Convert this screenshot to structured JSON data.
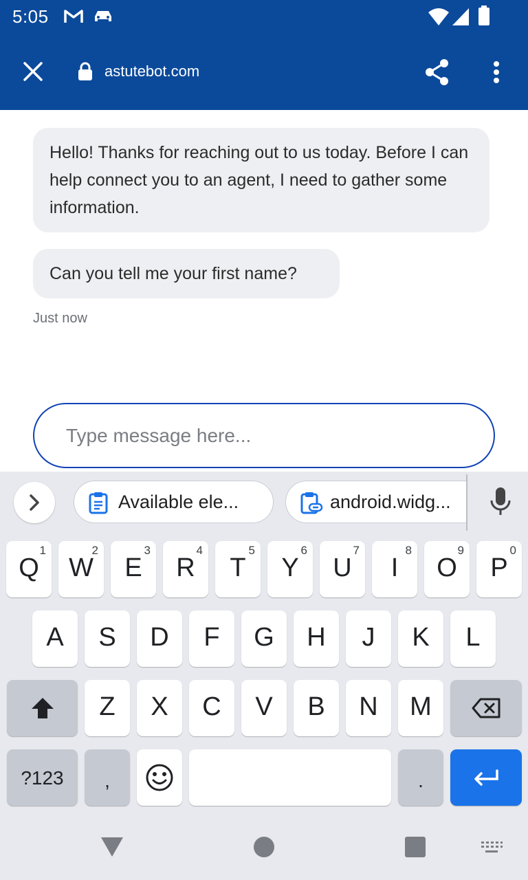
{
  "status": {
    "time": "5:05"
  },
  "browser": {
    "url": "astutebot.com"
  },
  "chat": {
    "messages": [
      "Hello! Thanks for reaching out to us today. Before I can help connect you to an agent, I need to gather some information.",
      "Can you tell me your first name?"
    ],
    "timestamp": "Just now"
  },
  "input": {
    "placeholder": "Type message here...",
    "value": ""
  },
  "keyboard": {
    "suggestions": [
      "Available ele...",
      "android.widg..."
    ],
    "row1": [
      {
        "c": "Q",
        "n": "1"
      },
      {
        "c": "W",
        "n": "2"
      },
      {
        "c": "E",
        "n": "3"
      },
      {
        "c": "R",
        "n": "4"
      },
      {
        "c": "T",
        "n": "5"
      },
      {
        "c": "Y",
        "n": "6"
      },
      {
        "c": "U",
        "n": "7"
      },
      {
        "c": "I",
        "n": "8"
      },
      {
        "c": "O",
        "n": "9"
      },
      {
        "c": "P",
        "n": "0"
      }
    ],
    "row2": [
      "A",
      "S",
      "D",
      "F",
      "G",
      "H",
      "J",
      "K",
      "L"
    ],
    "row3": [
      "Z",
      "X",
      "C",
      "V",
      "B",
      "N",
      "M"
    ],
    "symbols_label": "?123",
    "comma": ",",
    "period": ".",
    "accent_color": "#1a73e8"
  },
  "colors": {
    "header": "#0b4a9b",
    "bubble": "#eeeff2",
    "input_border": "#1143b5"
  }
}
